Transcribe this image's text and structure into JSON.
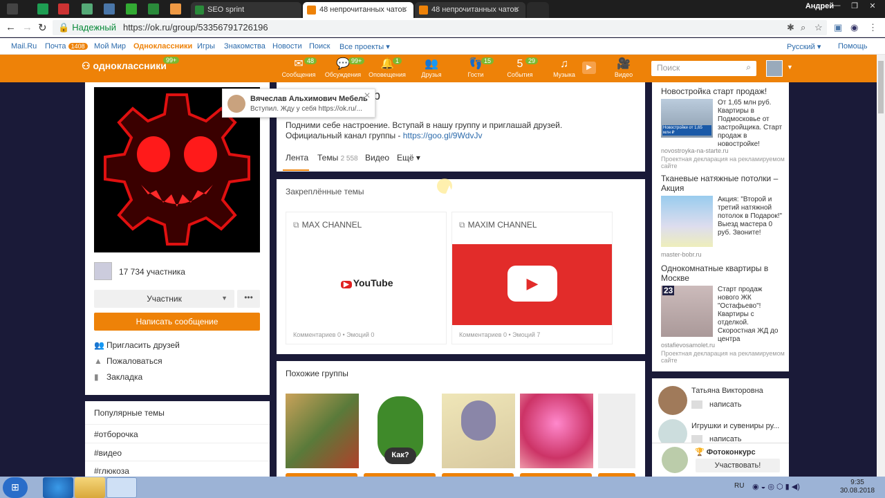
{
  "browser": {
    "tabs": [
      {
        "label": "SEO sprint"
      },
      {
        "label": "48 непрочитанных чатов"
      },
      {
        "label": "48 непрочитанных чатов"
      }
    ],
    "user": "Андрей",
    "secure_label": "Надежный",
    "url": "https://ok.ru/group/53356791726196"
  },
  "oknav": {
    "mailru": "Mail.Ru",
    "pochta": "Почта",
    "pochta_badge": "1408",
    "moy_mir": "Мой Мир",
    "odnoklassniki": "Одноклассники",
    "igry": "Игры",
    "znakomstva": "Знакомства",
    "novosti": "Новости",
    "poisk": "Поиск",
    "vse_proekty": "Все проекты ▾",
    "lang": "Русский ▾",
    "help": "Помощь"
  },
  "okbar": {
    "logo": "одноклассники",
    "logo_badge": "99+",
    "tools": [
      {
        "label": "Сообщения",
        "badge": "48",
        "icon": "✉"
      },
      {
        "label": "Обсуждения",
        "badge": "99+",
        "icon": "💬"
      },
      {
        "label": "Оповещения",
        "badge": "1",
        "icon": "🔔"
      },
      {
        "label": "Друзья",
        "badge": "",
        "icon": "👥"
      },
      {
        "label": "Гости",
        "badge": "15",
        "icon": "👣"
      },
      {
        "label": "События",
        "badge": "29",
        "icon": "5"
      },
      {
        "label": "Музыка",
        "badge": "",
        "icon": "♫"
      },
      {
        "label": "Видео",
        "badge": "",
        "icon": "🎥"
      }
    ],
    "search_placeholder": "Поиск"
  },
  "left": {
    "members": "17 734 участника",
    "member_btn": "Участник",
    "more": "•••",
    "write": "Написать сообщение",
    "actions": [
      "Пригласить друзей",
      "Пожаловаться",
      "Закладка"
    ],
    "popular_title": "Популярные темы",
    "tags": [
      "#отборочка",
      "#видео",
      "#глюкоза"
    ]
  },
  "center": {
    "title_tail": "р",
    "desc1": "Подними себе настроение. Вступай в нашу группу и приглашай друзей.",
    "desc2_prefix": "Официальный канал группы - ",
    "desc2_link": "https://goo.gl/9WdvJv",
    "tabs": [
      {
        "label": "Лента"
      },
      {
        "label": "Темы",
        "count": "2 558"
      },
      {
        "label": "Видео"
      },
      {
        "label": "Ещё ▾"
      }
    ],
    "pinned_title": "Закреплённые темы",
    "cards": [
      {
        "title": "MAX CHANNEL",
        "meta_comments": "Комментариев 0",
        "meta_emotions": "Эмоций 0"
      },
      {
        "title": "MAXIM CHANNEL",
        "meta_comments": "Комментариев 0",
        "meta_emotions": "Эмоций 7"
      }
    ],
    "youtube_logo": "YouTube",
    "similar_title": "Похожие группы",
    "similar_img_text": "Как?"
  },
  "toast": {
    "name": "Вячеслав Альхимович Мебель",
    "msg": "Вступил. Жду у себя  https://ok.ru/..."
  },
  "ads": [
    {
      "title": "Новостройка старт продаж!",
      "text": "От 1,65 млн руб. Квартиры в Подмосковье от застройщика. Старт продаж в новостройке!",
      "src": "novostroyka-na-starte.ru",
      "disc": "Проектная декларация на рекламируемом сайте",
      "img_caption": "Новостройки от 1,65 млн ₽"
    },
    {
      "title": "Тканевые натяжные потолки – Акция",
      "text": "Акция: \"Второй и третий натяжной потолок в Подарок!\" Выезд мастера 0 руб. Звоните!",
      "src": "master-bobr.ru"
    },
    {
      "title": "Однокомнатные квартиры в Москве",
      "text": "Старт продаж нового ЖК \"Остафьево\"! Квартиры с отделкой. Скоростная ЖД до центра",
      "src": "ostafievosamolet.ru",
      "disc": "Проектная декларация на рекламируемом сайте",
      "img_caption": "23"
    }
  ],
  "friends": [
    {
      "name": "Татьяна Викторовна",
      "action": "написать"
    },
    {
      "name": "Игрушки и сувениры ру...",
      "action": "написать"
    }
  ],
  "photocontest": {
    "title": "Фотоконкурс",
    "btn": "Участвовать!"
  },
  "taskbar": {
    "lang": "RU",
    "time": "9:35",
    "date": "30.08.2018"
  }
}
